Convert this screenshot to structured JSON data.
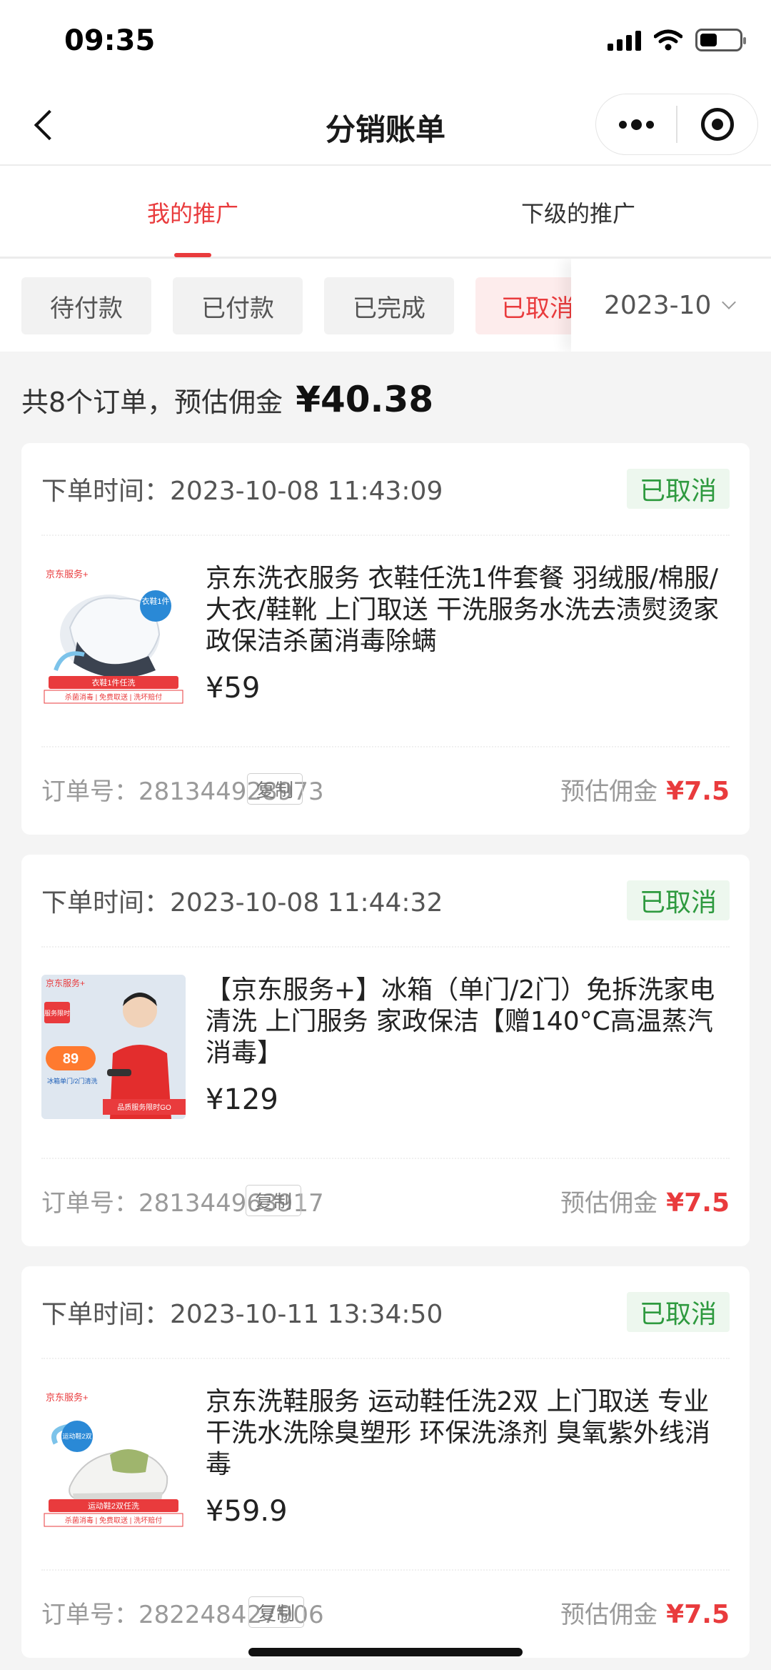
{
  "status_bar": {
    "time": "09:35"
  },
  "nav": {
    "title": "分销账单"
  },
  "tabs": [
    {
      "label": "我的推广",
      "active": true
    },
    {
      "label": "下级的推广",
      "active": false
    }
  ],
  "filters": {
    "chips": [
      "待付款",
      "已付款",
      "已完成",
      "已取消"
    ],
    "active_chip": "已取消",
    "month": "2023-10"
  },
  "summary": {
    "text": "共8个订单，预估佣金",
    "amount": "¥40.38"
  },
  "orders": [
    {
      "time_label": "下单时间：",
      "time": "2023-10-08 11:43:09",
      "status": "已取消",
      "title": "京东洗衣服务 衣鞋任洗1件套餐 羽绒服/棉服/大衣/鞋靴 上门取送 干洗服务水洗去渍熨烫家政保洁杀菌消毒除螨",
      "price": "¥59",
      "order_no_label": "订单号：",
      "order_no": "281344928973",
      "copy": "复制",
      "commission_label": "预估佣金",
      "commission": "¥7.5",
      "thumb": {
        "brand": "京东服务+",
        "tag": "衣鞋1件",
        "banner": "衣鞋1件任洗",
        "footer": "杀菌消毒 | 免费取送 | 洗坏赔付"
      }
    },
    {
      "time_label": "下单时间：",
      "time": "2023-10-08 11:44:32",
      "status": "已取消",
      "title": "【京东服务+】冰箱（单门/2门）免拆洗家电清洗 上门服务 家政保洁【赠140°C高温蒸汽消毒】",
      "price": "¥129",
      "order_no_label": "订单号：",
      "order_no": "281344963917",
      "copy": "复制",
      "commission_label": "预估佣金",
      "commission": "¥7.5",
      "thumb": {
        "brand": "京东服务+",
        "tag": "服务限时",
        "price": "89",
        "sub": "冰箱单门/2门清洗",
        "footer": "品质服务限时GO"
      }
    },
    {
      "time_label": "下单时间：",
      "time": "2023-10-11 13:34:50",
      "status": "已取消",
      "title": "京东洗鞋服务 运动鞋任洗2双 上门取送 专业干洗水洗除臭塑形 环保洗涤剂 臭氧紫外线消毒",
      "price": "¥59.9",
      "order_no_label": "订单号：",
      "order_no": "282248427906",
      "copy": "复制",
      "commission_label": "预估佣金",
      "commission": "¥7.5",
      "thumb": {
        "brand": "京东服务+",
        "tag": "运动鞋2双",
        "banner": "运动鞋2双任洗",
        "footer": "杀菌消毒 | 免费取送 | 洗坏赔付"
      }
    }
  ]
}
